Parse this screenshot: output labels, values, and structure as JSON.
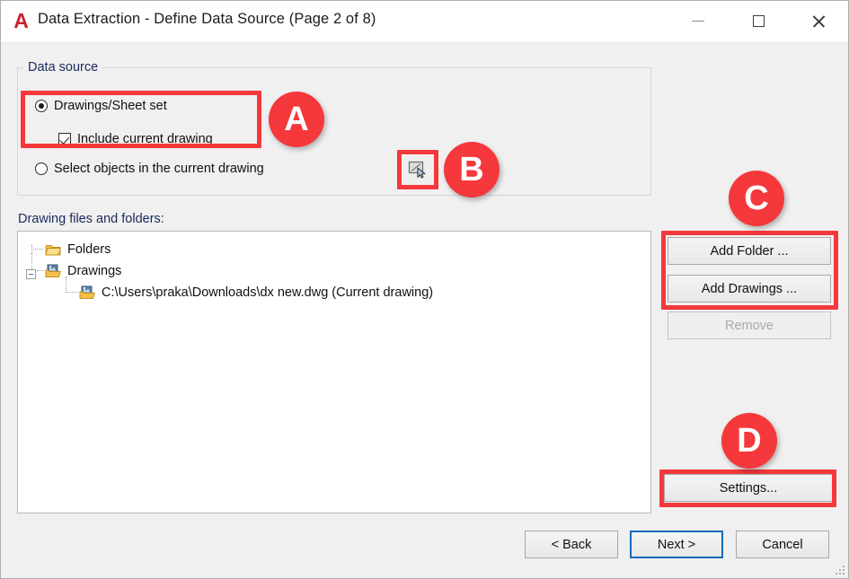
{
  "window": {
    "title": "Data Extraction - Define Data Source (Page 2 of 8)",
    "logo_glyph": "A",
    "logo_name": "autocad-logo-icon",
    "controls": {
      "minimize": "minimize-icon",
      "maximize": "maximize-icon",
      "close": "close-icon"
    },
    "accent_red": "#f5383b",
    "focus_blue": "#0c6bbd",
    "background": "#f0f0f0"
  },
  "data_source": {
    "group_label": "Data source",
    "options": [
      {
        "label": "Drawings/Sheet set",
        "type": "radio",
        "selected": true
      },
      {
        "label": "Include current drawing",
        "type": "checkbox",
        "checked": true
      },
      {
        "label": "Select objects in the current drawing",
        "type": "radio",
        "selected": false
      }
    ],
    "select_objects_button": {
      "icon": "select-objects-icon",
      "tooltip": "Select objects in the current drawing"
    }
  },
  "tree": {
    "label": "Drawing files and folders:",
    "nodes": [
      {
        "text": "Folders",
        "icon": "folder-icon",
        "indent": 0,
        "expandable": false
      },
      {
        "text": "Drawings",
        "icon": "drawing-folder-icon",
        "indent": 0,
        "expandable": true,
        "expanded": true
      },
      {
        "text": "C:\\Users\\praka\\Downloads\\dx new.dwg (Current drawing)",
        "icon": "drawing-file-icon",
        "indent": 1,
        "expandable": false
      }
    ]
  },
  "side_buttons": {
    "add_folder": "Add Folder ...",
    "add_drawings": "Add Drawings ...",
    "remove": "Remove",
    "remove_disabled": true,
    "settings": "Settings..."
  },
  "footer_buttons": {
    "back": "< Back",
    "next": "Next >",
    "cancel": "Cancel",
    "default_focus": "Next >"
  },
  "annotations": [
    {
      "id": "A",
      "label": "A",
      "targets": "Drawings/Sheet set option group"
    },
    {
      "id": "B",
      "label": "B",
      "targets": "Select objects button"
    },
    {
      "id": "C",
      "label": "C",
      "targets": "Add Folder / Add Drawings buttons"
    },
    {
      "id": "D",
      "label": "D",
      "targets": "Settings button"
    }
  ]
}
